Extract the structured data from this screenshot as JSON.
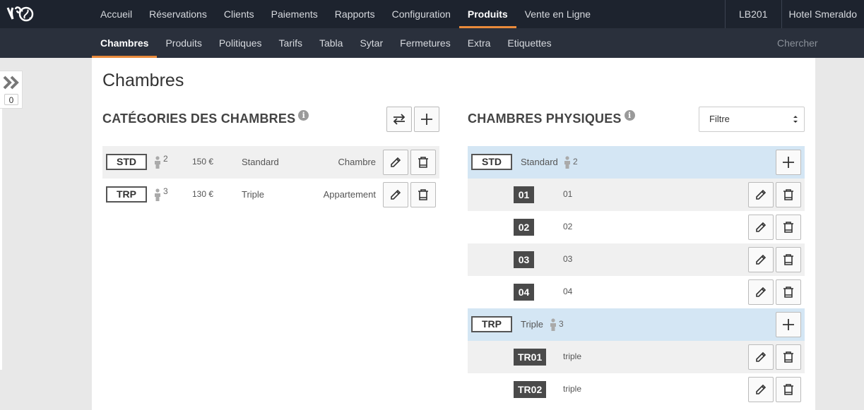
{
  "topnav": {
    "items": [
      "Accueil",
      "Réservations",
      "Clients",
      "Paiements",
      "Rapports",
      "Configuration",
      "Produits",
      "Vente en Ligne"
    ],
    "active_index": 6,
    "account_code": "LB201",
    "hotel_name": "Hotel Smeraldo"
  },
  "subnav": {
    "items": [
      "Chambres",
      "Produits",
      "Politiques",
      "Tarifs",
      "Tabla",
      "Sytar",
      "Fermetures",
      "Extra",
      "Etiquettes"
    ],
    "active_index": 0,
    "search_placeholder": "Chercher"
  },
  "sidebar": {
    "count": "0"
  },
  "page": {
    "title": "Chambres"
  },
  "categories": {
    "title": "CATÉGORIES DES CHAMBRES",
    "info_symbol": "i",
    "rows": [
      {
        "code": "STD",
        "persons": "2",
        "price": "150 €",
        "name": "Standard",
        "type": "Chambre"
      },
      {
        "code": "TRP",
        "persons": "3",
        "price": "130 €",
        "name": "Triple",
        "type": "Appartement"
      }
    ]
  },
  "physical": {
    "title": "CHAMBRES PHYSIQUES",
    "info_symbol": "i",
    "filter_label": "Filtre",
    "groups": [
      {
        "code": "STD",
        "name": "Standard",
        "persons": "2",
        "rooms": [
          {
            "code": "01",
            "name": "01"
          },
          {
            "code": "02",
            "name": "02"
          },
          {
            "code": "03",
            "name": "03"
          },
          {
            "code": "04",
            "name": "04"
          }
        ]
      },
      {
        "code": "TRP",
        "name": "Triple",
        "persons": "3",
        "rooms": [
          {
            "code": "TR01",
            "name": "triple"
          },
          {
            "code": "TR02",
            "name": "triple"
          }
        ]
      }
    ]
  },
  "colors": {
    "navbar": "#1d232e",
    "subnavbar": "#2a303c",
    "accent": "#e98a3b",
    "group_row": "#d4e6f4",
    "room_tag": "#4a4a4a"
  },
  "icons": {
    "edit": "pencil-icon",
    "delete": "trash-icon",
    "add": "plus-icon",
    "swap": "swap-icon",
    "person": "person-icon",
    "info": "info-icon",
    "expand": "double-chevron-right-icon"
  }
}
